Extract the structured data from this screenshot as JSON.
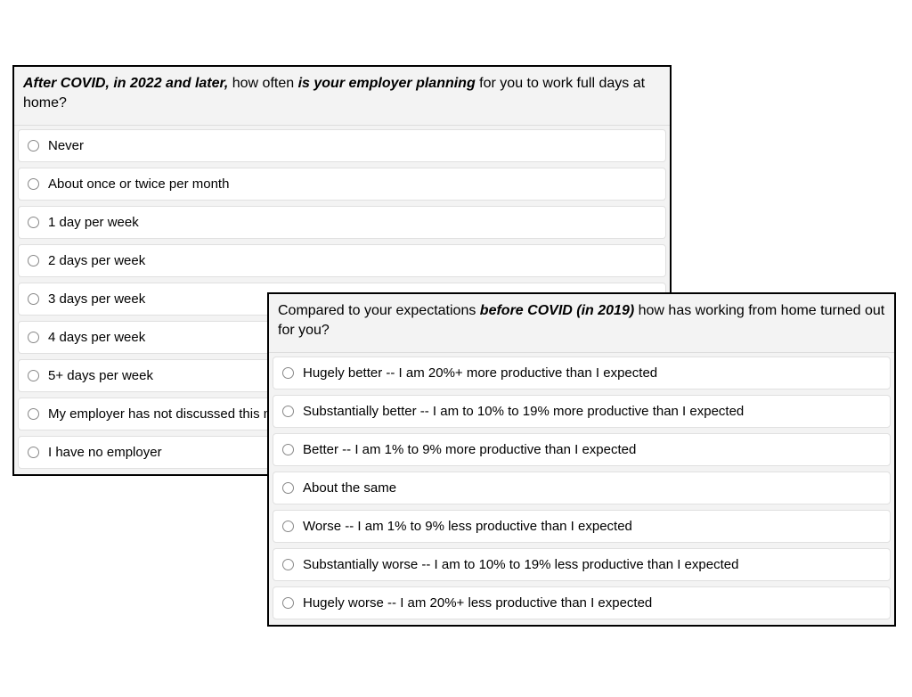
{
  "panel_a": {
    "question_parts": {
      "p1": "After COVID, in 2022 and later,",
      "p2": " how often ",
      "p3": "is your employer planning",
      "p4": " for you to work full days at home?"
    },
    "options": [
      "Never",
      "About once or twice per month",
      "1 day per week",
      "2 days per week",
      "3 days per week",
      "4 days per week",
      "5+ days per week",
      "My employer has not discussed this matter with me or announced a policy",
      "I have no employer"
    ]
  },
  "panel_b": {
    "question_parts": {
      "p1": "Compared to your expectations ",
      "p2": "before COVID (in 2019)",
      "p3": " how has working from home turned out for you?"
    },
    "options": [
      "Hugely better -- I am 20%+ more productive than I expected",
      "Substantially better -- I am to 10% to 19% more productive than I expected",
      "Better -- I am 1% to 9% more productive than I expected",
      "About the same",
      "Worse -- I am 1% to 9% less productive than I expected",
      "Substantially worse -- I am to 10% to 19% less productive than I expected",
      "Hugely worse -- I am 20%+ less productive than I expected"
    ]
  }
}
